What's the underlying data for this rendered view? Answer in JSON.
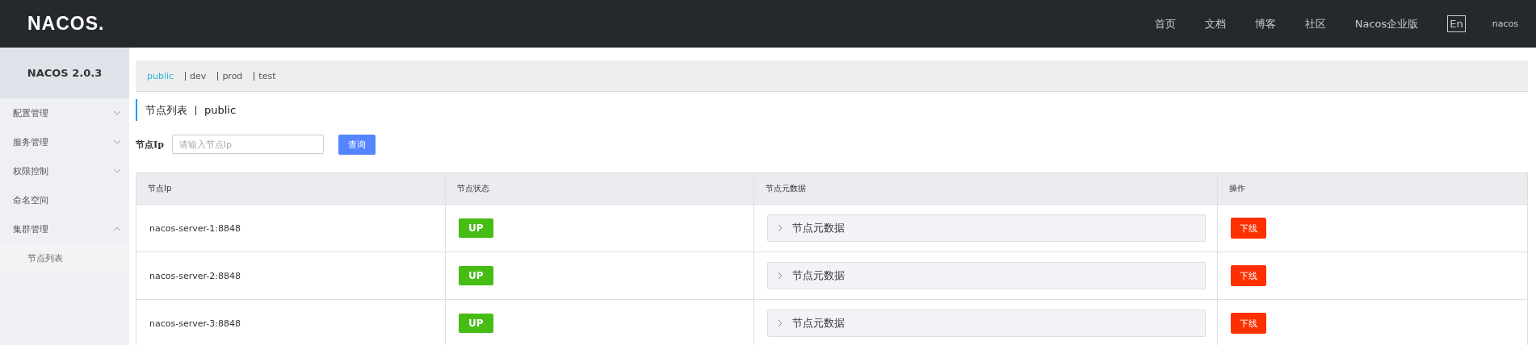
{
  "header": {
    "logo": "NACOS.",
    "nav": [
      "首页",
      "文档",
      "博客",
      "社区",
      "Nacos企业版"
    ],
    "language": "En",
    "user": "nacos"
  },
  "sidebar": {
    "title": "NACOS 2.0.3",
    "items": [
      {
        "label": "配置管理",
        "expanded": false
      },
      {
        "label": "服务管理",
        "expanded": false
      },
      {
        "label": "权限控制",
        "expanded": false
      },
      {
        "label": "命名空间"
      },
      {
        "label": "集群管理",
        "expanded": true,
        "children": [
          {
            "label": "节点列表",
            "selected": true
          }
        ]
      }
    ]
  },
  "namespaces": [
    {
      "label": "public",
      "selected": true
    },
    {
      "label": "dev",
      "selected": false
    },
    {
      "label": "prod",
      "selected": false
    },
    {
      "label": "test",
      "selected": false
    }
  ],
  "page_title": {
    "title": "节点列表",
    "namespace": "public"
  },
  "search": {
    "label": "节点Ip",
    "placeholder": "请输入节点Ip",
    "button": "查询"
  },
  "table": {
    "columns": [
      "节点Ip",
      "节点状态",
      "节点元数据",
      "操作"
    ],
    "rows": [
      {
        "ip": "nacos-server-1:8848",
        "status": "UP",
        "metadata": "节点元数据",
        "metadata_expanded": false,
        "action": "下线"
      },
      {
        "ip": "nacos-server-2:8848",
        "status": "UP",
        "metadata": "节点元数据",
        "metadata_expanded": false,
        "action": "下线"
      },
      {
        "ip": "nacos-server-3:8848",
        "status": "UP",
        "metadata": "节点元数据",
        "metadata_expanded": false,
        "action": "下线"
      }
    ]
  }
}
